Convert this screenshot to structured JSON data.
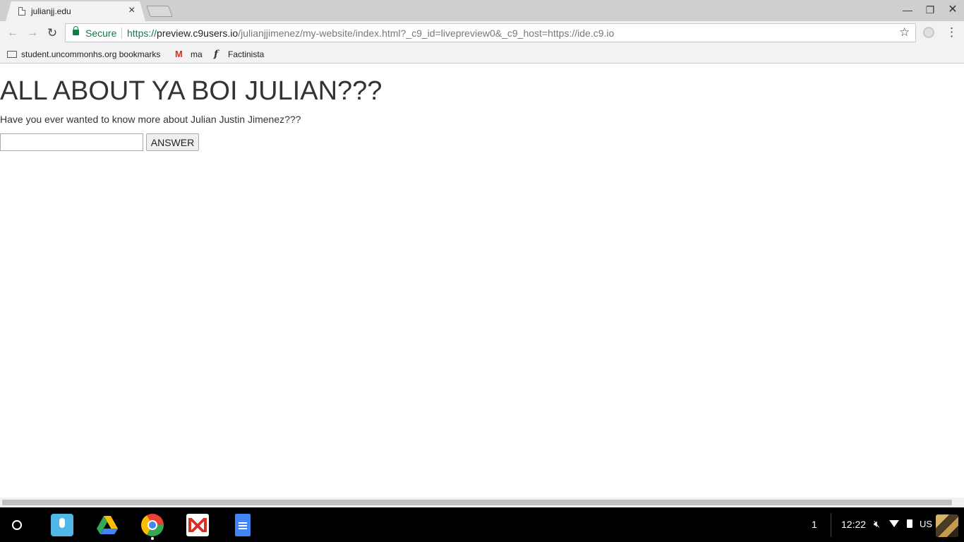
{
  "browser": {
    "tab": {
      "title": "julianjj.edu"
    },
    "omnibox": {
      "security_label": "Secure",
      "url_scheme": "https://",
      "url_host": "preview.c9users.io",
      "url_path": "/julianjjimenez/my-website/index.html?_c9_id=livepreview0&_c9_host=https://ide.c9.io"
    },
    "bookmarks": [
      {
        "label": "student.uncommonhs.org bookmarks",
        "icon": "folder-icon"
      },
      {
        "label": "ma",
        "icon": "gmail-icon"
      },
      {
        "label": "Factinista",
        "icon": "factinista-icon"
      }
    ],
    "icons": {
      "gmail_glyph": "M",
      "factinista_glyph": "f"
    }
  },
  "page": {
    "heading": "ALL ABOUT YA BOI JULIAN???",
    "intro": "Have you ever wanted to know more about Julian Justin Jimenez???",
    "answer_input": {
      "value": "",
      "placeholder": ""
    },
    "answer_button": "ANSWER"
  },
  "shelf": {
    "apps": [
      "voice-search",
      "google-drive",
      "chrome",
      "gmail",
      "google-docs"
    ],
    "notification_count": "1",
    "time": "12:22",
    "ime": "US"
  },
  "colors": {
    "secure_green": "#0b8043",
    "heading_text": "#333333",
    "shelf_bg": "#000000"
  }
}
